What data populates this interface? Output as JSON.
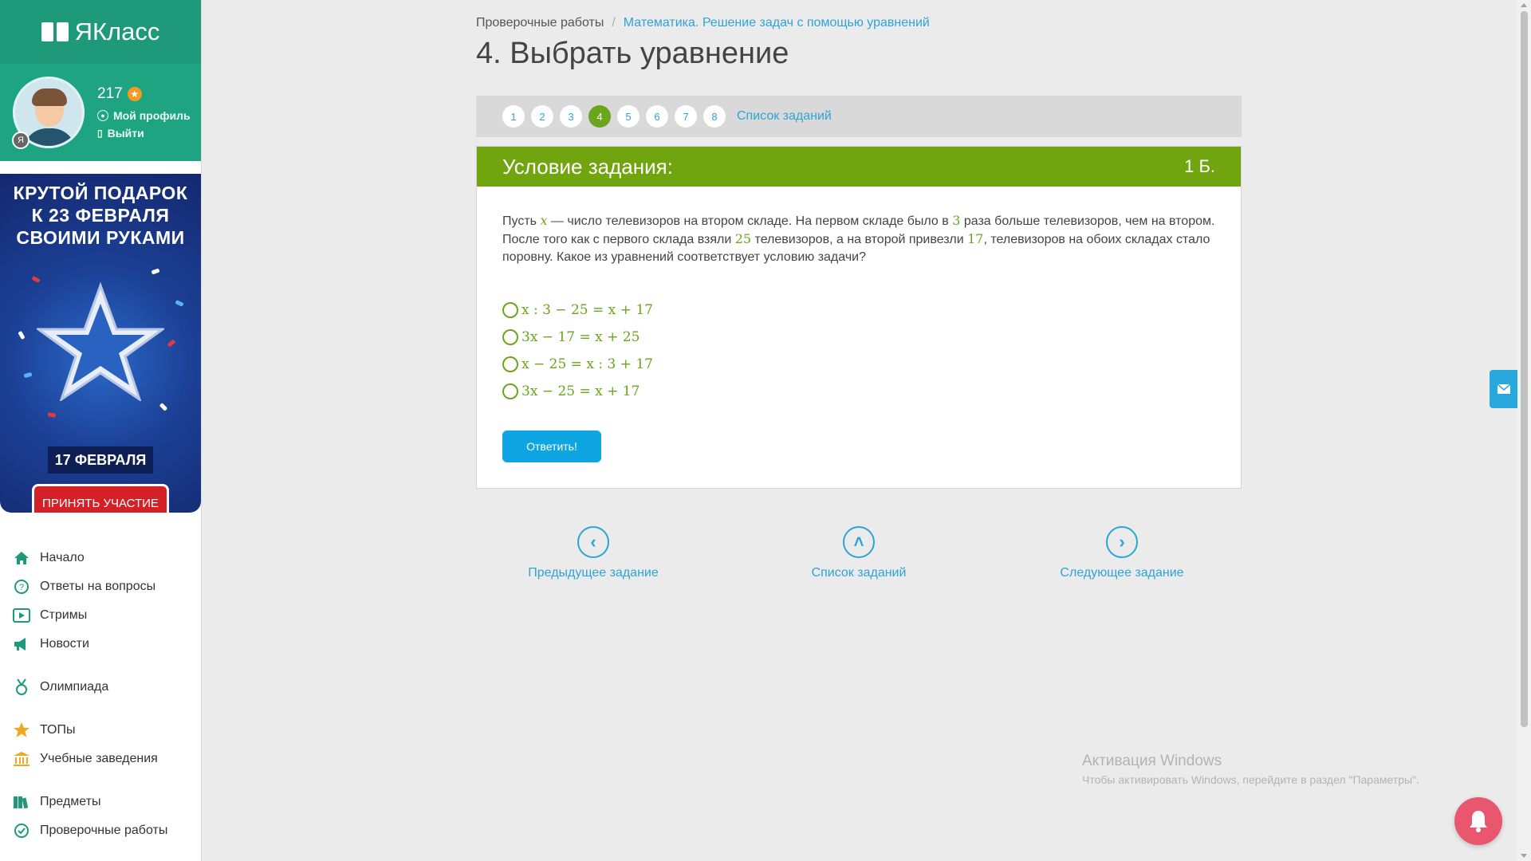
{
  "sidebar": {
    "logo_text": "ЯКласс",
    "profile": {
      "score": "217",
      "my_profile": "Мой профиль",
      "logout": "Выйти"
    },
    "banner": {
      "line1": "КРУТОЙ ПОДАРОК",
      "line2": "К 23 ФЕВРАЛЯ",
      "line3": "СВОИМИ РУКАМИ",
      "date": "17 ФЕВРАЛЯ",
      "button": "ПРИНЯТЬ УЧАСТИЕ"
    },
    "nav": [
      {
        "label": "Начало",
        "icon": "home-icon"
      },
      {
        "label": "Ответы на вопросы",
        "icon": "question-icon"
      },
      {
        "label": "Стримы",
        "icon": "play-icon"
      },
      {
        "label": "Новости",
        "icon": "megaphone-icon"
      },
      {
        "label": "Олимпиада",
        "icon": "medal-icon"
      },
      {
        "label": "ТОПы",
        "icon": "star-icon"
      },
      {
        "label": "Учебные заведения",
        "icon": "school-icon"
      },
      {
        "label": "Предметы",
        "icon": "books-icon"
      },
      {
        "label": "Проверочные работы",
        "icon": "check-circle-icon"
      }
    ]
  },
  "breadcrumb": {
    "root": "Проверочные работы",
    "separator": "/",
    "current": "Математика. Решение задач с помощью уравнений"
  },
  "page_title": "4. Выбрать уравнение",
  "pager": {
    "pages": [
      "1",
      "2",
      "3",
      "4",
      "5",
      "6",
      "7",
      "8"
    ],
    "active": "4",
    "list_link": "Список заданий"
  },
  "task": {
    "header": "Условие задания:",
    "points": "1 Б.",
    "text_parts": {
      "p1": "Пусть ",
      "x": "x",
      "p2": " — число телевизоров на втором складе. На первом складе было в ",
      "n1": "3",
      "p3": " раза больше телевизоров, чем на втором. После того как с первого склада взяли ",
      "n2": "25",
      "p4": " телевизоров, а на второй привезли ",
      "n3": "17",
      "p5": ", телевизоров на обоих складах стало поровну. Какое из уравнений соответствует условию задачи?"
    },
    "options": [
      "x : 3 − 25 = x + 17",
      "3x − 17 = x + 25",
      "x − 25 = x : 3 + 17",
      "3x − 25 = x + 17"
    ],
    "answer_button": "Ответить!"
  },
  "bottom_nav": {
    "prev": "Предыдущее задание",
    "list": "Список заданий",
    "next": "Следующее задание"
  },
  "watermark": {
    "line1": "Активация Windows",
    "line2": "Чтобы активировать Windows, перейдите в раздел \"Параметры\"."
  },
  "colors": {
    "brand_green": "#1e9a7b",
    "task_green": "#70a50f",
    "link_blue": "#2ea3d6",
    "button_blue": "#0ea5e3"
  }
}
